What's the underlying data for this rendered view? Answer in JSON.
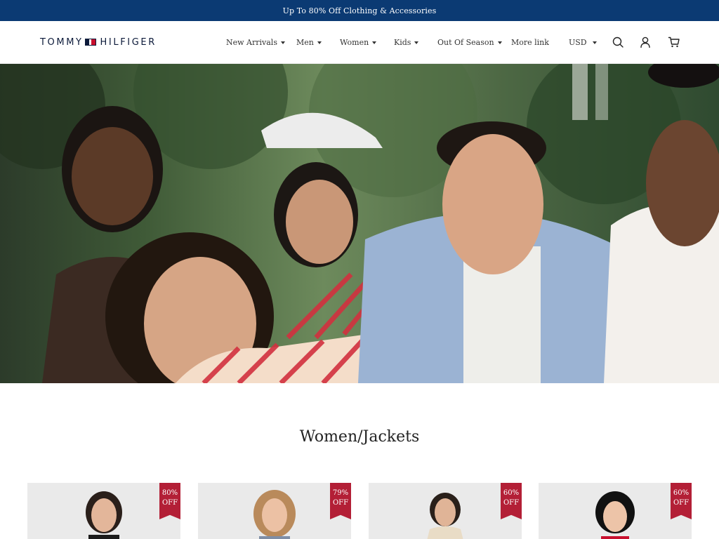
{
  "promo": {
    "text": "Up To 80% Off Clothing & Accessories"
  },
  "brand": {
    "left": "TOMMY",
    "right": "HILFIGER",
    "colors": {
      "navy": "#0c1a3a",
      "red": "#c8102e",
      "promo_bg": "#0b3a73"
    }
  },
  "nav": {
    "items": [
      {
        "label": "New Arrivals",
        "has_dropdown": true
      },
      {
        "label": "Men",
        "has_dropdown": true
      },
      {
        "label": "Women",
        "has_dropdown": true
      },
      {
        "label": "Kids",
        "has_dropdown": true
      },
      {
        "label": "Out Of Season",
        "has_dropdown": true
      },
      {
        "label": "More link",
        "has_dropdown": false
      }
    ],
    "currency": "USD",
    "icons": [
      "search-icon",
      "account-icon",
      "cart-icon"
    ]
  },
  "hero": {
    "description_icon": "hero-image"
  },
  "section": {
    "title": "Women/Jackets"
  },
  "products": [
    {
      "discount_line1": "80%",
      "discount_line2": "OFF"
    },
    {
      "discount_line1": "79%",
      "discount_line2": "OFF"
    },
    {
      "discount_line1": "60%",
      "discount_line2": "OFF"
    },
    {
      "discount_line1": "60%",
      "discount_line2": "OFF"
    }
  ],
  "ribbon_color": "#b31f36"
}
